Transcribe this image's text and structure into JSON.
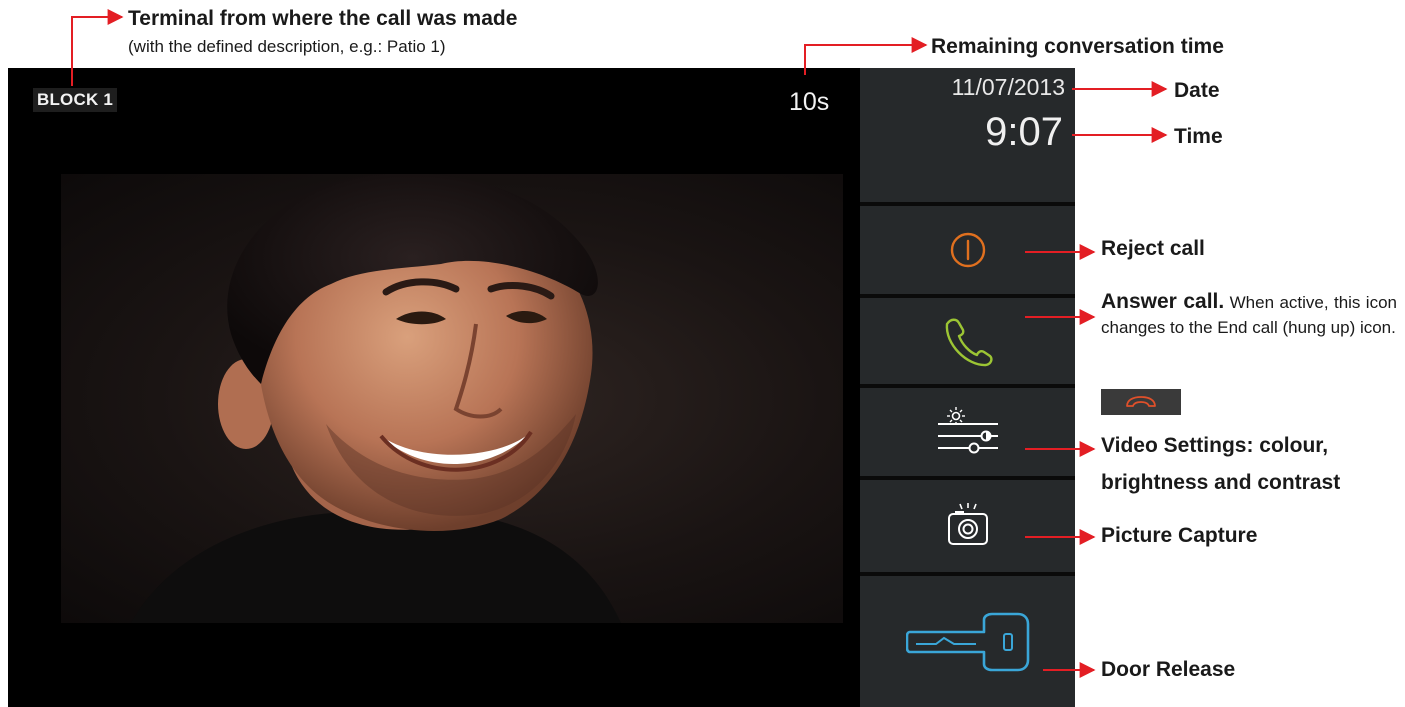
{
  "screen": {
    "terminal_label": "BLOCK 1",
    "remaining_time": "10s",
    "date": "11/07/2013",
    "time": "9:07"
  },
  "buttons": [
    {
      "name": "reject-call",
      "icon": "power-icon",
      "color": "#e0701f"
    },
    {
      "name": "answer-call",
      "icon": "phone-handset-icon",
      "color": "#9cc534"
    },
    {
      "name": "video-settings",
      "icon": "sliders-icon",
      "color": "#ffffff"
    },
    {
      "name": "picture-capture",
      "icon": "camera-icon",
      "color": "#ffffff"
    },
    {
      "name": "door-release",
      "icon": "key-icon",
      "color": "#3aa6d8"
    }
  ],
  "annotations": {
    "terminal_title": "Terminal from where the call was made",
    "terminal_sub": "(with the defined description, e.g.: Patio 1)",
    "remaining": "Remaining conversation time",
    "date": "Date",
    "time": "Time",
    "reject": "Reject call",
    "answer_title": "Answer call.",
    "answer_desc": "When active, this icon changes to the End call (hung up) icon.",
    "video_settings_line1": "Video Settings: colour,",
    "video_settings_line2": "brightness and contrast",
    "picture": "Picture Capture",
    "door": "Door Release"
  },
  "colors": {
    "arrow": "#e31e24",
    "panel": "#26292b",
    "screen": "#000000",
    "end_call_icon": "#e0502a"
  }
}
